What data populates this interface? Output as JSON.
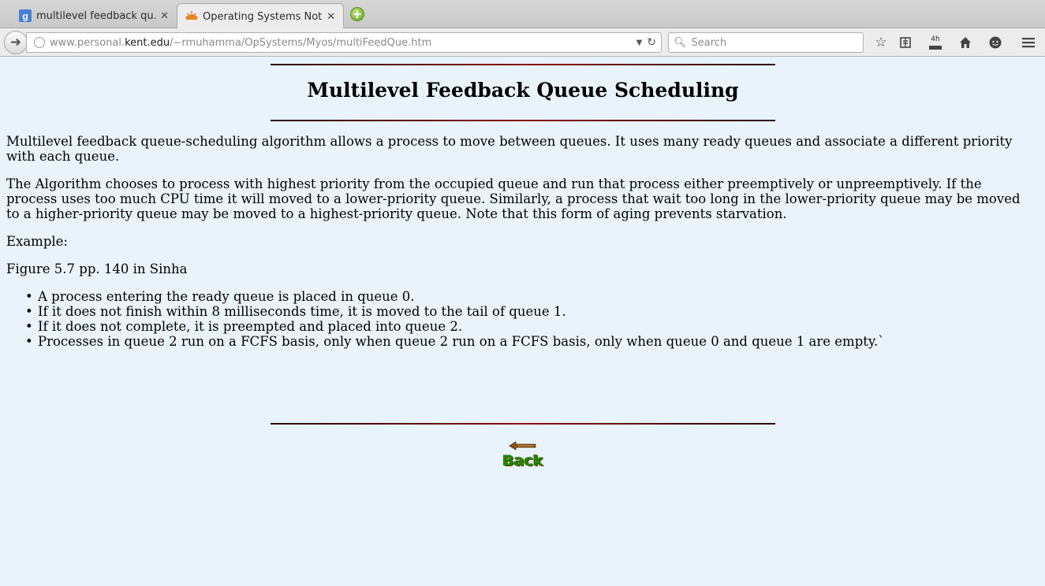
{
  "browser": {
    "tabs": [
      {
        "title": "multilevel feedback qu...",
        "favicon": "google-icon",
        "active": false
      },
      {
        "title": "Operating Systems Notes",
        "favicon": "sun-icon",
        "active": true
      }
    ],
    "url": {
      "prefix": "www.personal.",
      "domain": "kent.edu",
      "path": "/~rmuhamma/OpSystems/Myos/multiFeedQue.htm"
    },
    "search_placeholder": "Search",
    "toolbar_icons": [
      "star-icon",
      "reading-list-icon",
      "downloads-icon",
      "home-icon",
      "chat-icon",
      "menu-icon"
    ],
    "downloads_badge": "4h"
  },
  "page": {
    "title": "Multilevel Feedback Queue Scheduling",
    "paragraphs": [
      "Multilevel feedback queue-scheduling algorithm allows a process to move between queues. It uses many ready queues and associate a different priority with each queue.",
      "The Algorithm chooses to process with highest priority from the occupied queue and run that process either preemptively or unpreemptively. If the process uses too much CPU time it will moved to a lower-priority queue. Similarly, a process that wait too long in the lower-priority queue may be moved to a higher-priority queue may be moved to a highest-priority queue. Note that this form of aging prevents starvation.",
      "Example:",
      "Figure 5.7 pp. 140 in Sinha"
    ],
    "bullets": [
      "A process entering the ready queue is placed in queue 0.",
      "If it does not finish within 8 milliseconds time, it is moved to the tail of queue 1.",
      "If it does not complete, it is preempted and placed into queue 2.",
      "Processes in queue 2 run on a FCFS basis, only when queue 2 run on a FCFS basis, only when queue 0 and queue 1 are empty.`"
    ],
    "back_label": "Back"
  },
  "colors": {
    "page_background": "#e8f3fb",
    "rule": "#8b1010",
    "back_text": "#1f8a00"
  }
}
